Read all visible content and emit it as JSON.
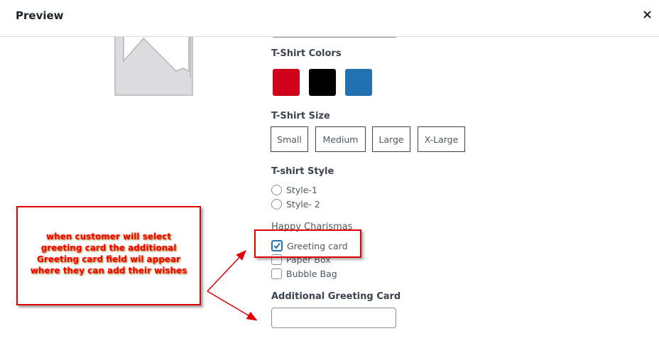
{
  "header": {
    "title": "Preview",
    "close_icon": "close-icon"
  },
  "product": {
    "image_icon": "image-placeholder-icon"
  },
  "colors": {
    "label": "T-Shirt Colors",
    "options": [
      {
        "name": "red",
        "hex": "#d0021b"
      },
      {
        "name": "black",
        "hex": "#000000"
      },
      {
        "name": "blue",
        "hex": "#2271b1"
      }
    ]
  },
  "sizes": {
    "label": "T-Shirt Size",
    "options": [
      "Small",
      "Medium",
      "Large",
      "X-Large"
    ]
  },
  "style": {
    "label": "T-shirt Style",
    "options": [
      {
        "label": "Style-1",
        "selected": false
      },
      {
        "label": "Style- 2",
        "selected": false
      }
    ]
  },
  "gift": {
    "label": "Happy Charismas",
    "options": [
      {
        "label": "Greeting card",
        "checked": true
      },
      {
        "label": "Paper Box",
        "checked": false
      },
      {
        "label": "Bubble Bag",
        "checked": false
      }
    ]
  },
  "greeting_field": {
    "label": "Additional Greeting Card",
    "value": ""
  },
  "annotation": {
    "lines": [
      "when customer will select",
      "greeting card the additional",
      "Greeting card field wil appear",
      "where they can add their wishes"
    ],
    "color": "#ff0000"
  }
}
